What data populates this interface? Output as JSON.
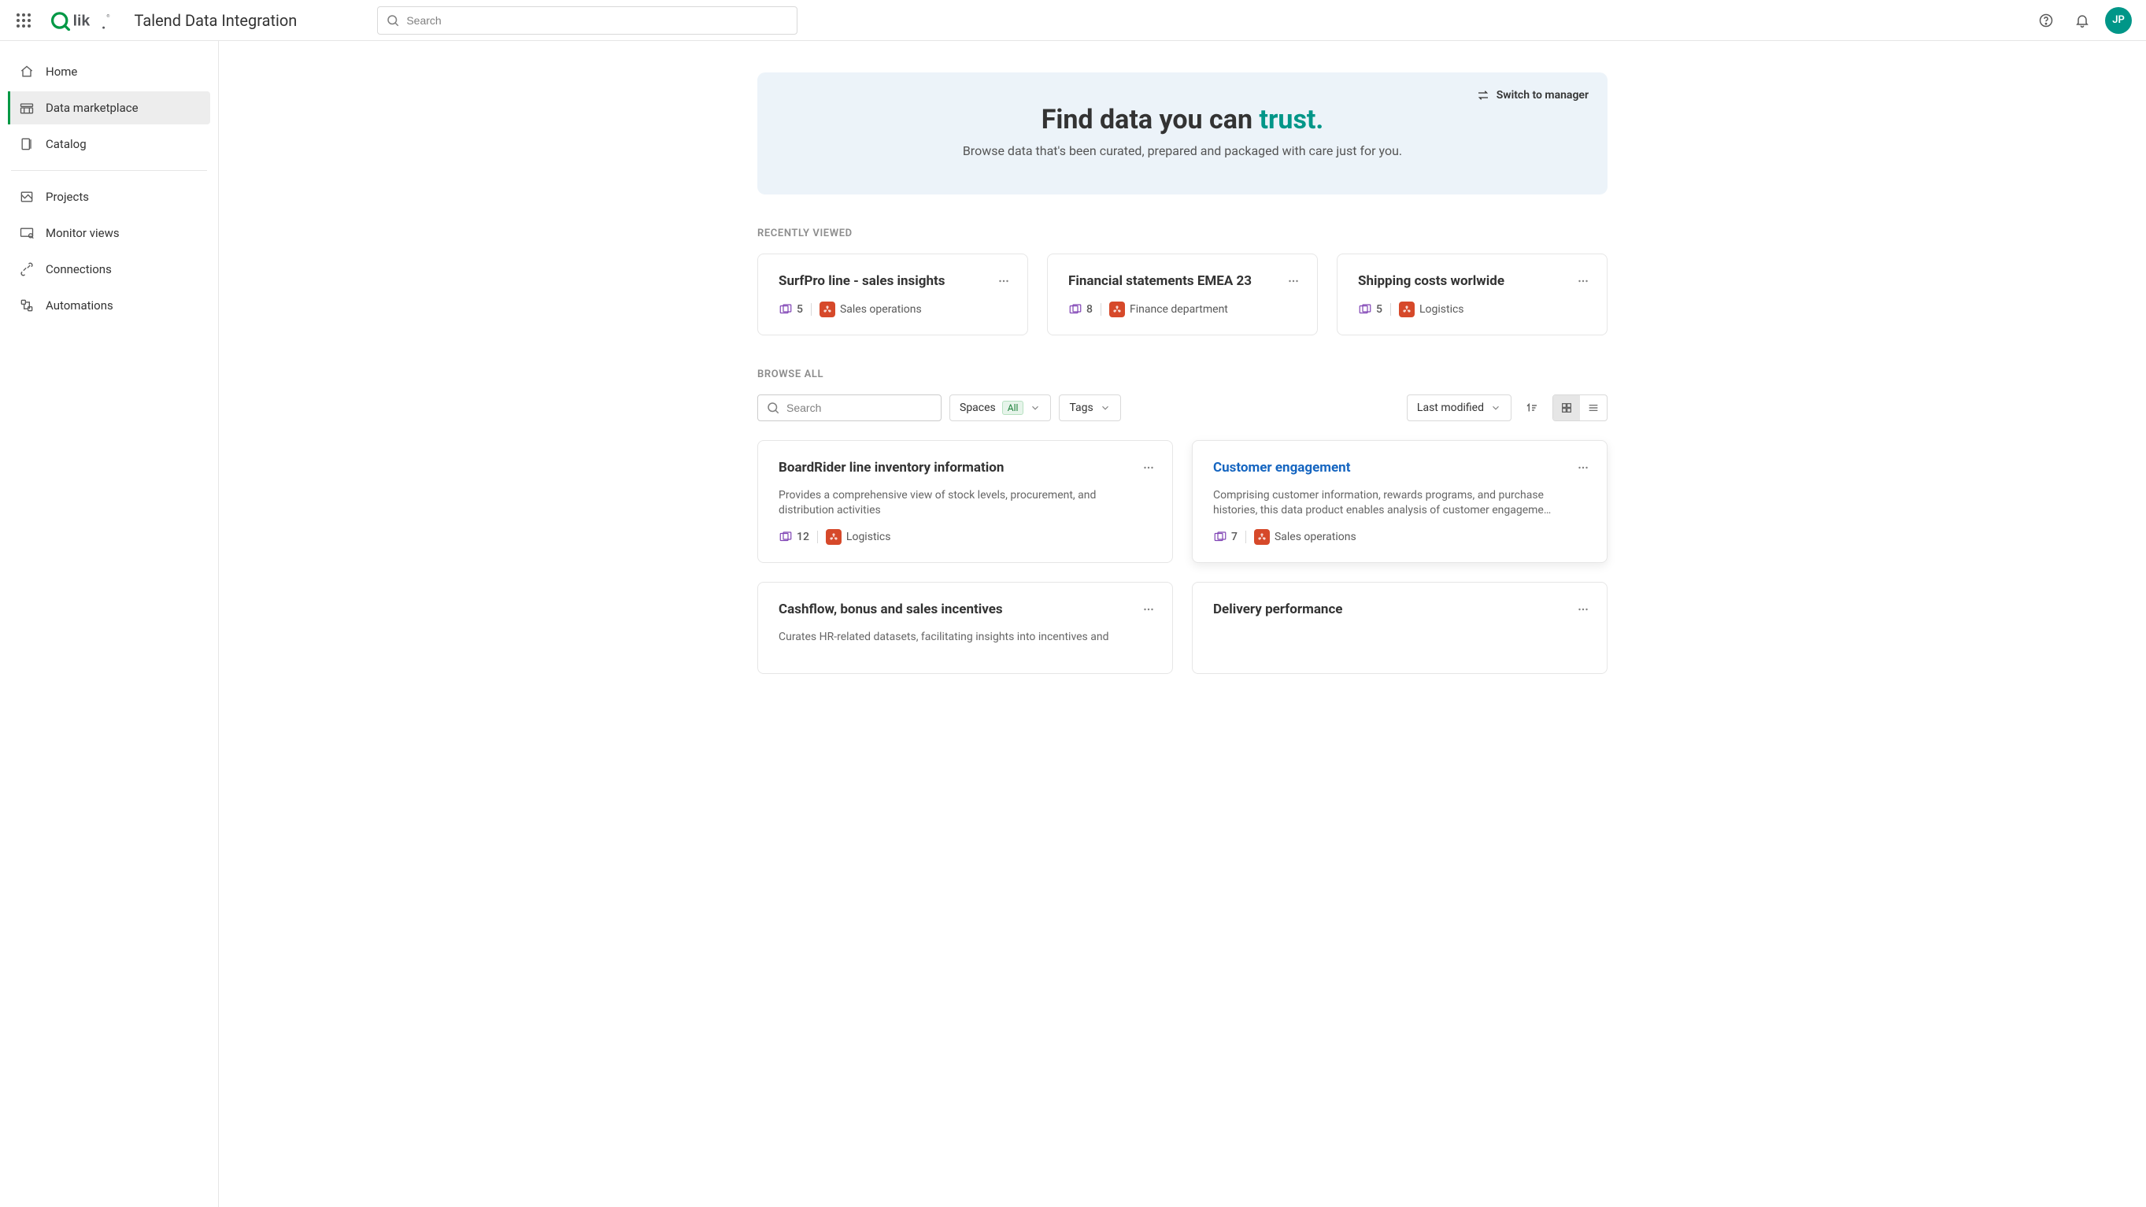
{
  "header": {
    "product_title": "Talend Data Integration",
    "search_placeholder": "Search",
    "avatar_initials": "JP"
  },
  "sidebar": {
    "items": [
      {
        "id": "home",
        "label": "Home",
        "icon": "home-icon",
        "active": false
      },
      {
        "id": "data-marketplace",
        "label": "Data marketplace",
        "icon": "marketplace-icon",
        "active": true
      },
      {
        "id": "catalog",
        "label": "Catalog",
        "icon": "catalog-icon",
        "active": false
      },
      {
        "id": "projects",
        "label": "Projects",
        "icon": "projects-icon",
        "active": false
      },
      {
        "id": "monitor-views",
        "label": "Monitor views",
        "icon": "monitor-icon",
        "active": false
      },
      {
        "id": "connections",
        "label": "Connections",
        "icon": "connections-icon",
        "active": false
      },
      {
        "id": "automations",
        "label": "Automations",
        "icon": "automations-icon",
        "active": false
      }
    ]
  },
  "hero": {
    "title_plain": "Find data you can ",
    "title_accent": "trust.",
    "subtitle": "Browse data that's been curated, prepared and packaged with care just for you.",
    "switch_label": "Switch to manager"
  },
  "recently_viewed": {
    "heading": "RECENTLY VIEWED",
    "cards": [
      {
        "title": "SurfPro line - sales insights",
        "count": "5",
        "space": "Sales operations"
      },
      {
        "title": "Financial statements EMEA 23",
        "count": "8",
        "space": "Finance department"
      },
      {
        "title": "Shipping costs worlwide",
        "count": "5",
        "space": "Logistics"
      }
    ]
  },
  "browse_all": {
    "heading": "BROWSE ALL",
    "search_placeholder": "Search",
    "filter_spaces_label": "Spaces",
    "filter_spaces_chip": "All",
    "filter_tags_label": "Tags",
    "sort_label": "Last modified",
    "cards": [
      {
        "title": "BoardRider line inventory information",
        "desc": "Provides a comprehensive view of stock levels, procurement, and distribution activities",
        "count": "12",
        "space": "Logistics",
        "highlight": false
      },
      {
        "title": "Customer engagement",
        "desc": "Comprising customer information, rewards programs, and purchase histories, this data product enables analysis of customer engageme…",
        "count": "7",
        "space": "Sales operations",
        "highlight": true
      },
      {
        "title": "Cashflow, bonus and sales incentives",
        "desc": "Curates HR-related datasets, facilitating insights into incentives and",
        "count": "",
        "space": "",
        "highlight": false
      },
      {
        "title": "Delivery performance",
        "desc": "",
        "count": "",
        "space": "",
        "highlight": false
      }
    ]
  }
}
